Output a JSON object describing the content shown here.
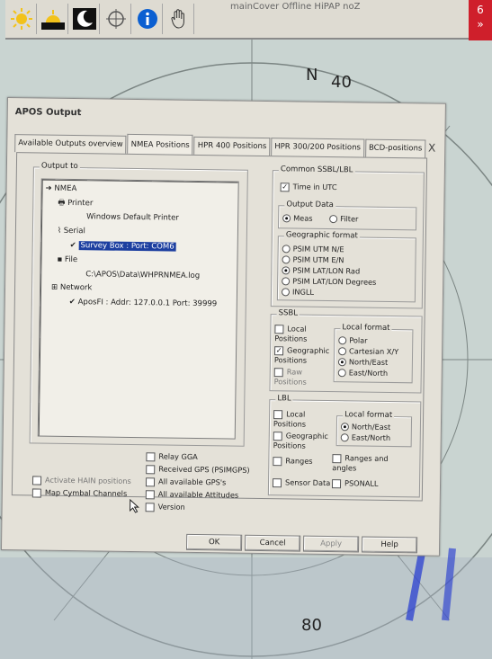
{
  "window": {
    "title": "mainCover Offline HiPAP noZ",
    "alarm_count": "6",
    "compass_n": "N",
    "compass_40": "40",
    "compass_80": "80"
  },
  "toolbar": {
    "icons": [
      "sun-icon",
      "sunset-icon",
      "moon-icon",
      "crosshair-icon",
      "info-icon",
      "hand-icon"
    ]
  },
  "dialog": {
    "title": "APOS Output",
    "close": "X",
    "tabs": [
      "Available Outputs overview",
      "NMEA Positions",
      "HPR 400 Positions",
      "HPR 300/200 Positions",
      "BCD-positions"
    ],
    "output_to": {
      "label": "Output to",
      "tree": {
        "nmea": "NMEA",
        "printer": "Printer",
        "printer_child": "Windows Default Printer",
        "serial": "Serial",
        "serial_child": "Survey Box : Port: COM6",
        "file": "File",
        "file_child": "C:\\APOS\\Data\\WHPRNMEA.log",
        "network": "Network",
        "network_child": "AposFI : Addr: 127.0.0.1 Port: 39999"
      }
    },
    "common": {
      "label": "Common SSBL/LBL",
      "time_utc": "Time in UTC",
      "output_data": {
        "label": "Output Data",
        "meas": "Meas",
        "filter": "Filter"
      },
      "geo_format": {
        "label": "Geographic format",
        "options": [
          "PSIM UTM N/E",
          "PSIM UTM E/N",
          "PSIM LAT/LON Rad",
          "PSIM LAT/LON Degrees",
          "INGLL"
        ]
      }
    },
    "ssbl": {
      "label": "SSBL",
      "local": "Local Positions",
      "geographic": "Geographic Positions",
      "raw": "Raw Positions",
      "local_format": {
        "label": "Local format",
        "options": [
          "Polar",
          "Cartesian X/Y",
          "North/East",
          "East/North"
        ]
      }
    },
    "lbl": {
      "label": "LBL",
      "local": "Local Positions",
      "geographic": "Geographic Positions",
      "ranges": "Ranges",
      "ranges_angles": "Ranges and angles",
      "sensor_data": "Sensor Data",
      "psonall": "PSONALL",
      "local_format": {
        "label": "Local format",
        "options": [
          "North/East",
          "East/North"
        ]
      }
    },
    "bottom_checks": {
      "relay_gga": "Relay GGA",
      "received_gps": "Received GPS (PSIMGPS)",
      "all_gps": "All available GPS's",
      "all_att": "All available Attitudes",
      "version": "Version",
      "activate_hain": "Activate HAIN positions",
      "map_cymbal": "Map Cymbal Channels"
    },
    "buttons": {
      "ok": "OK",
      "cancel": "Cancel",
      "apply": "Apply",
      "help": "Help"
    }
  }
}
